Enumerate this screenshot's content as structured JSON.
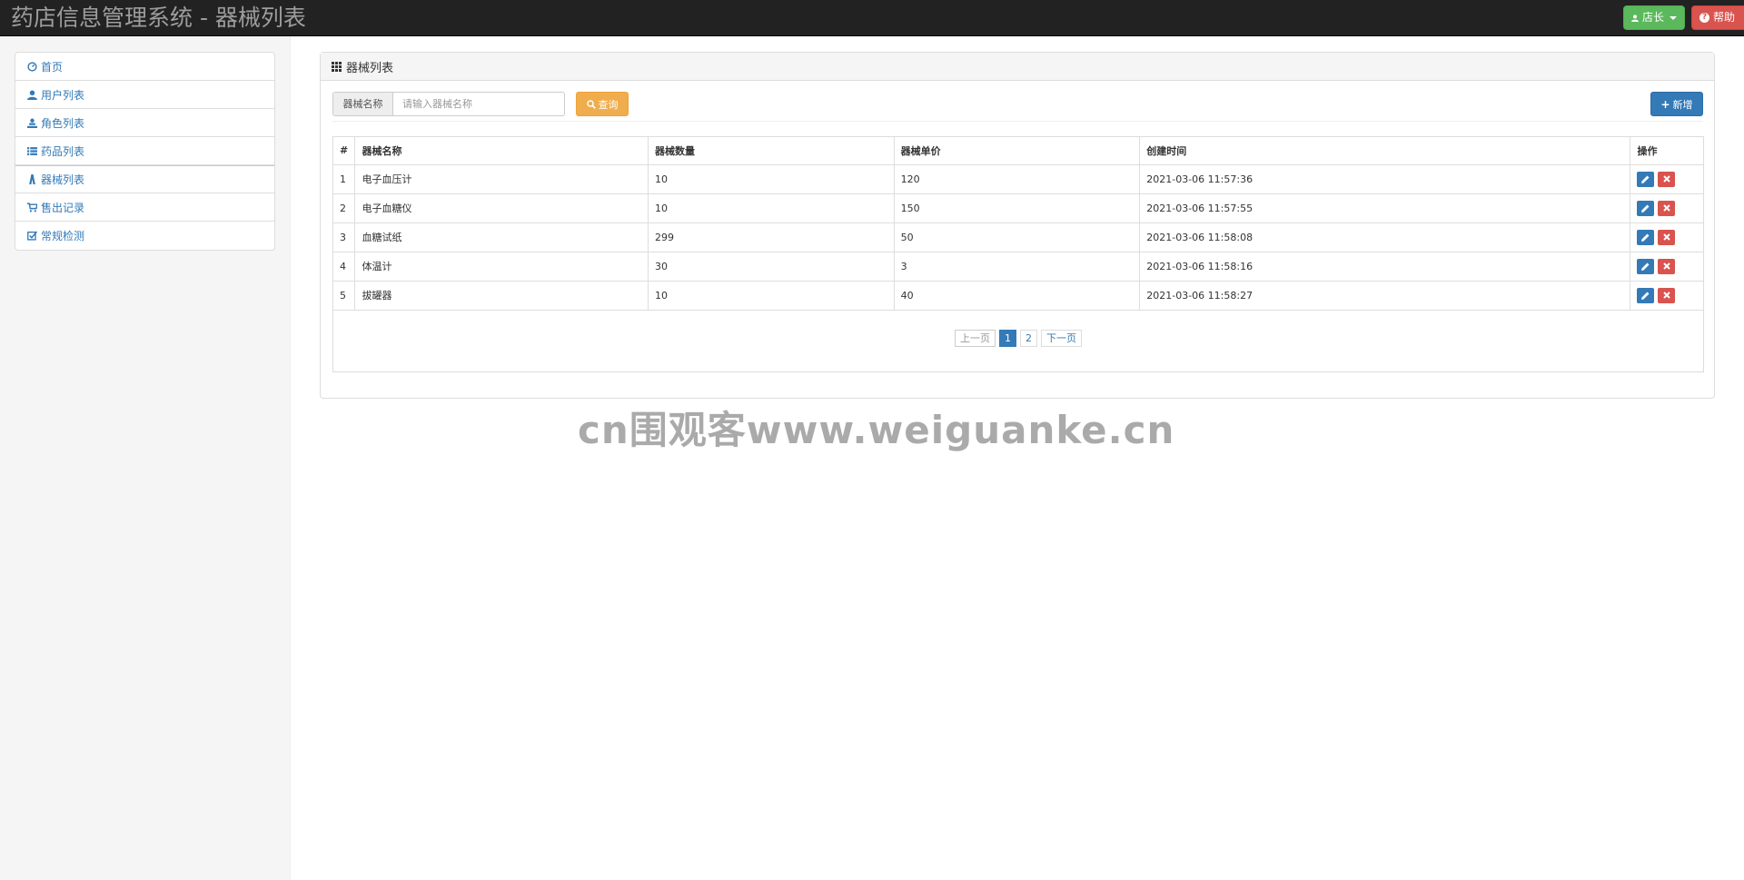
{
  "app": {
    "title": "药店信息管理系统 - 器械列表"
  },
  "navbar": {
    "user_label": "店长",
    "help_label": "帮助"
  },
  "sidebar": {
    "items": [
      {
        "label": "首页",
        "icon": "dashboard-icon"
      },
      {
        "label": "用户列表",
        "icon": "user-icon"
      },
      {
        "label": "角色列表",
        "icon": "role-icon"
      },
      {
        "label": "药品列表",
        "icon": "list-icon"
      },
      {
        "label": "器械列表",
        "icon": "instrument-icon",
        "active": true
      },
      {
        "label": "售出记录",
        "icon": "cart-icon"
      },
      {
        "label": "常规检测",
        "icon": "check-icon"
      }
    ]
  },
  "panel": {
    "title": "器械列表"
  },
  "search": {
    "label": "器械名称",
    "placeholder": "请输入器械名称",
    "button": "查询"
  },
  "toolbar": {
    "add_label": "新增"
  },
  "table": {
    "headers": [
      "#",
      "器械名称",
      "器械数量",
      "器械单价",
      "创建时间",
      "操作"
    ],
    "rows": [
      [
        "1",
        "电子血压计",
        "10",
        "120",
        "2021-03-06 11:57:36"
      ],
      [
        "2",
        "电子血糖仪",
        "10",
        "150",
        "2021-03-06 11:57:55"
      ],
      [
        "3",
        "血糖试纸",
        "299",
        "50",
        "2021-03-06 11:58:08"
      ],
      [
        "4",
        "体温计",
        "30",
        "3",
        "2021-03-06 11:58:16"
      ],
      [
        "5",
        "拔罐器",
        "10",
        "40",
        "2021-03-06 11:58:27"
      ]
    ]
  },
  "pagination": {
    "prev": "上一页",
    "pages": [
      "1",
      "2"
    ],
    "current": "1",
    "next": "下一页"
  },
  "watermark": "cn围观客www.weiguanke.cn",
  "colors": {
    "primary": "#337ab7",
    "success": "#5cb85c",
    "danger": "#d9534f",
    "warning": "#f0ad4e",
    "navbar": "#222222"
  }
}
